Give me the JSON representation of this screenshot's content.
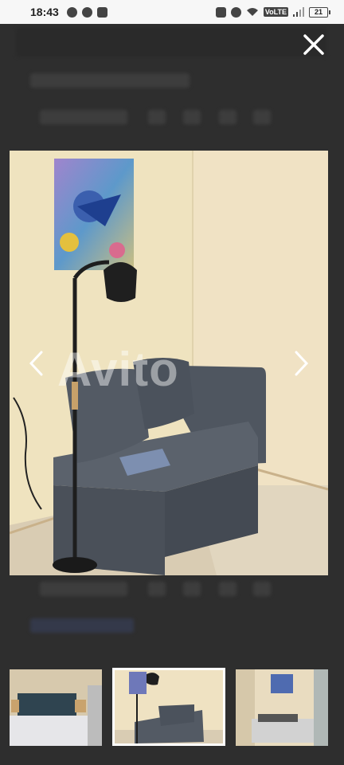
{
  "status_bar": {
    "time": "18:43",
    "volte": "VoLTE",
    "battery": "21"
  },
  "viewer": {
    "watermark": "Avito",
    "icons": {
      "close": "close-icon",
      "prev": "chevron-left-icon",
      "next": "chevron-right-icon"
    },
    "thumbnails": [
      "bedroom-thumbnail",
      "sofa-room-thumbnail",
      "room-thumbnail"
    ],
    "selected_thumbnail": 2
  },
  "colors": {
    "overlay": "#303030",
    "thumb_border": "#ffffff"
  }
}
